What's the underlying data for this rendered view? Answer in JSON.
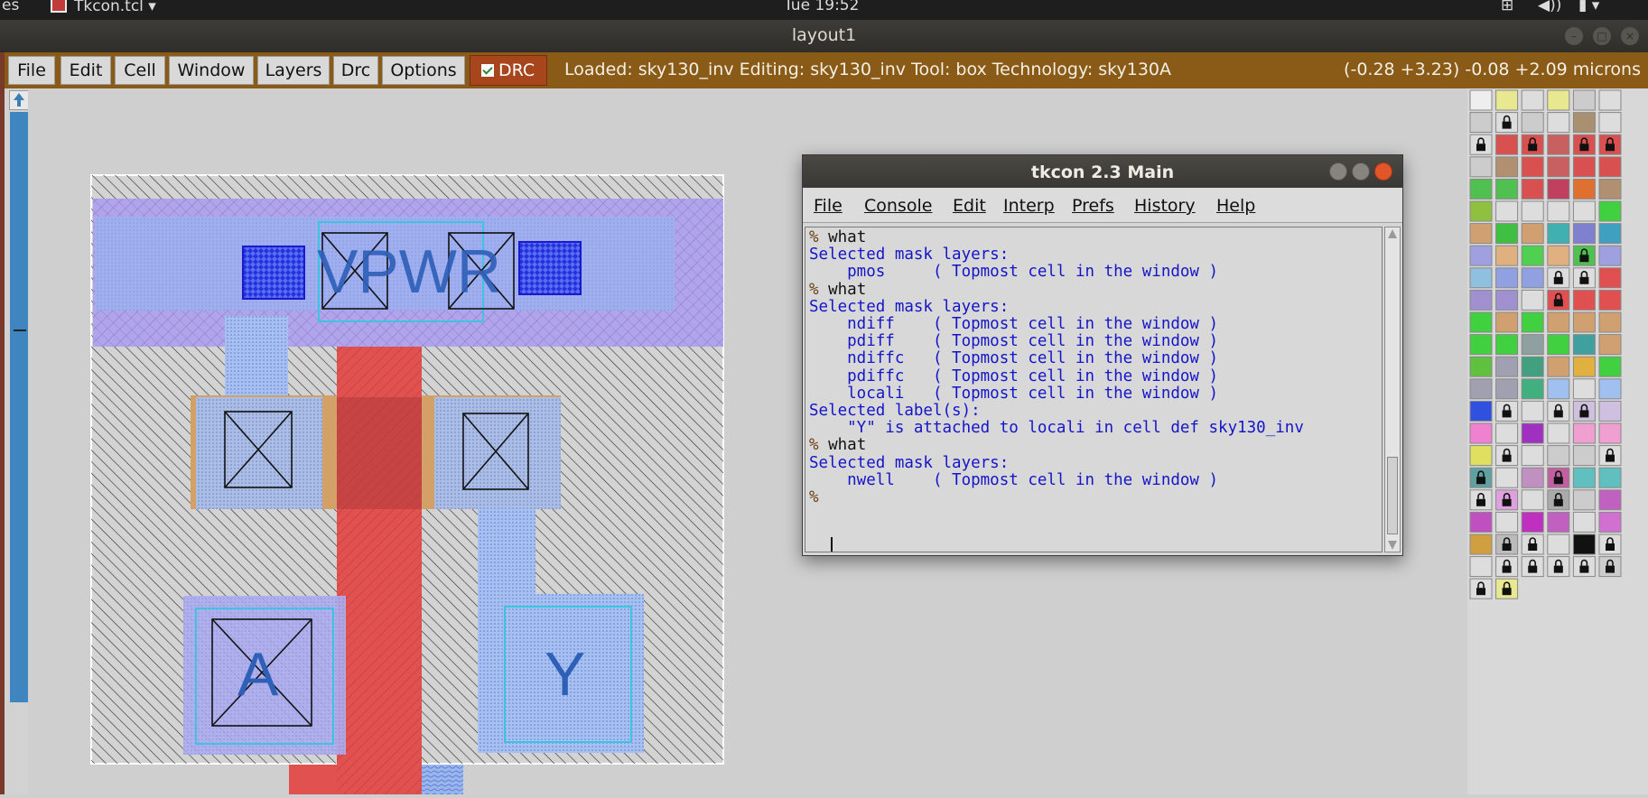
{
  "topbar": {
    "activities_partial": "es",
    "app_menu": "Tkcon.tcl",
    "clock": "Tue 19:52"
  },
  "window": {
    "title": "layout1"
  },
  "magic": {
    "menu": [
      "File",
      "Edit",
      "Cell",
      "Window",
      "Layers",
      "Drc",
      "Options"
    ],
    "drc_label": "DRC",
    "drc_checked": true,
    "status": "Loaded: sky130_inv Editing: sky130_inv Tool: box  Technology: sky130A",
    "coordinates": "(-0.28 +3.23) -0.08 +2.09 microns",
    "labels": {
      "vpwr": "VPWR",
      "a": "A",
      "y": "Y"
    },
    "colors": {
      "menubar": "#8a5a17",
      "drc_button": "#a7461c",
      "nwell": "#a79cf0",
      "poly": "#e0504f",
      "ndiff": "#d7a065",
      "locali": "#a0b8f0",
      "label_text": "#2f60b8"
    }
  },
  "tkcon": {
    "title": "tkcon 2.3 Main",
    "menu": [
      "File",
      "Console",
      "Edit",
      "Interp",
      "Prefs",
      "History",
      "Help"
    ],
    "lines": [
      {
        "type": "prompt",
        "text": "what"
      },
      {
        "type": "res",
        "text": "Selected mask layers:"
      },
      {
        "type": "res",
        "text": "    pmos     ( Topmost cell in the window )"
      },
      {
        "type": "prompt",
        "text": "what"
      },
      {
        "type": "res",
        "text": "Selected mask layers:"
      },
      {
        "type": "res",
        "text": "    ndiff    ( Topmost cell in the window )"
      },
      {
        "type": "res",
        "text": "    pdiff    ( Topmost cell in the window )"
      },
      {
        "type": "res",
        "text": "    ndiffc   ( Topmost cell in the window )"
      },
      {
        "type": "res",
        "text": "    pdiffc   ( Topmost cell in the window )"
      },
      {
        "type": "res",
        "text": "    locali   ( Topmost cell in the window )"
      },
      {
        "type": "res",
        "text": "Selected label(s):"
      },
      {
        "type": "res",
        "text": "    \"Y\" is attached to locali in cell def sky130_inv"
      },
      {
        "type": "prompt",
        "text": "what"
      },
      {
        "type": "res",
        "text": "Selected mask layers:"
      },
      {
        "type": "res",
        "text": "    nwell    ( Topmost cell in the window )"
      },
      {
        "type": "prompt",
        "text": ""
      }
    ],
    "prompt_symbol": "%"
  }
}
